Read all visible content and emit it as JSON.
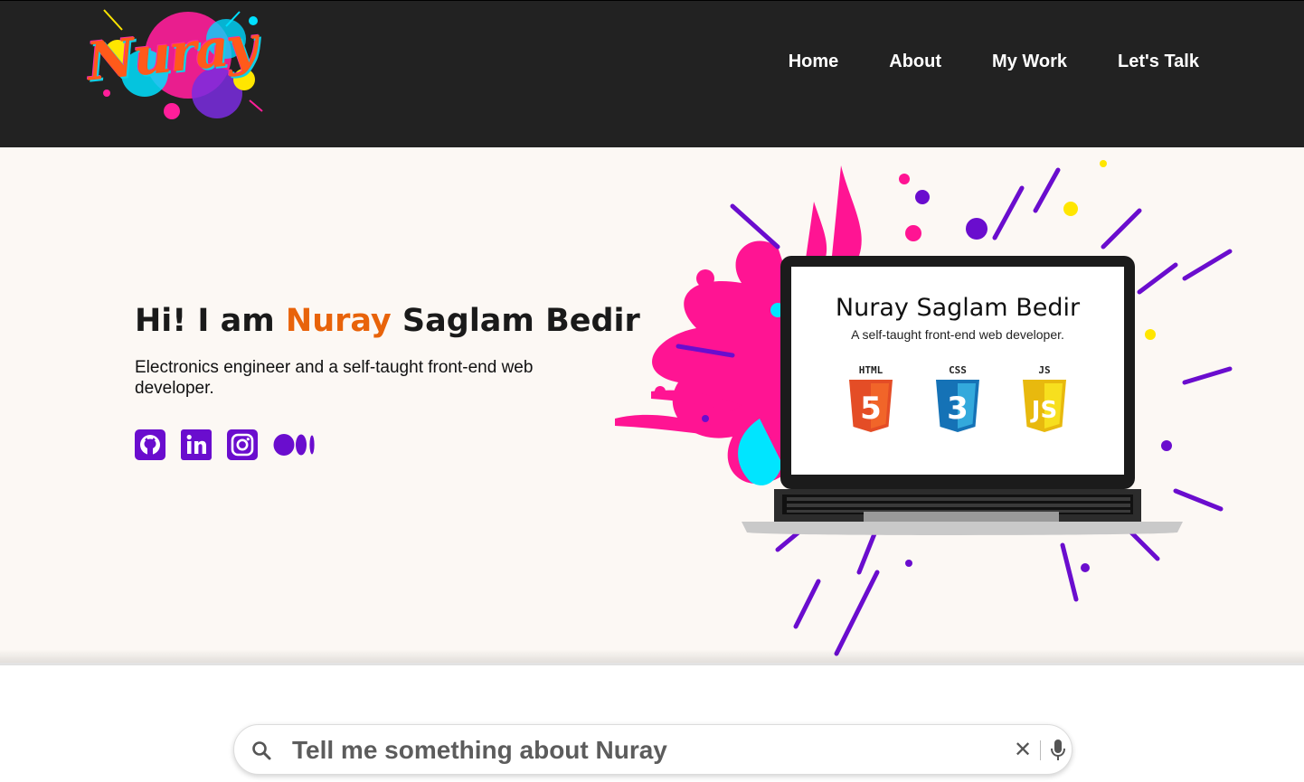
{
  "header": {
    "logo_text": "Nuray",
    "nav": [
      {
        "label": "Home"
      },
      {
        "label": "About"
      },
      {
        "label": "My Work"
      },
      {
        "label": "Let's Talk"
      }
    ]
  },
  "hero": {
    "greeting_prefix": "Hi! I am ",
    "greeting_name": "Nuray",
    "greeting_suffix": " Saglam Bedir",
    "subtitle": "Electronics engineer and a self-taught front-end web developer.",
    "socials": [
      {
        "icon": "github-icon"
      },
      {
        "icon": "linkedin-icon"
      },
      {
        "icon": "instagram-icon"
      },
      {
        "icon": "medium-icon"
      }
    ],
    "laptop": {
      "title": "Nuray Saglam Bedir",
      "subtitle": "A self-taught front-end web developer.",
      "techs": [
        {
          "label": "HTML",
          "number": "5",
          "color": "#e44d26"
        },
        {
          "label": "CSS",
          "number": "3",
          "color": "#1572b6"
        },
        {
          "label": "JS",
          "number": "JS",
          "color": "#f0c419"
        }
      ]
    }
  },
  "search": {
    "placeholder": "Tell me something about Nuray",
    "value": ""
  },
  "colors": {
    "header_bg": "#222222",
    "accent_orange": "#e8630a",
    "social_purple": "#6a0dce",
    "hero_bg": "#fcf8f4",
    "splash_pink": "#ff1493",
    "splash_purple": "#6a0dce",
    "splash_cyan": "#00e5ff"
  }
}
